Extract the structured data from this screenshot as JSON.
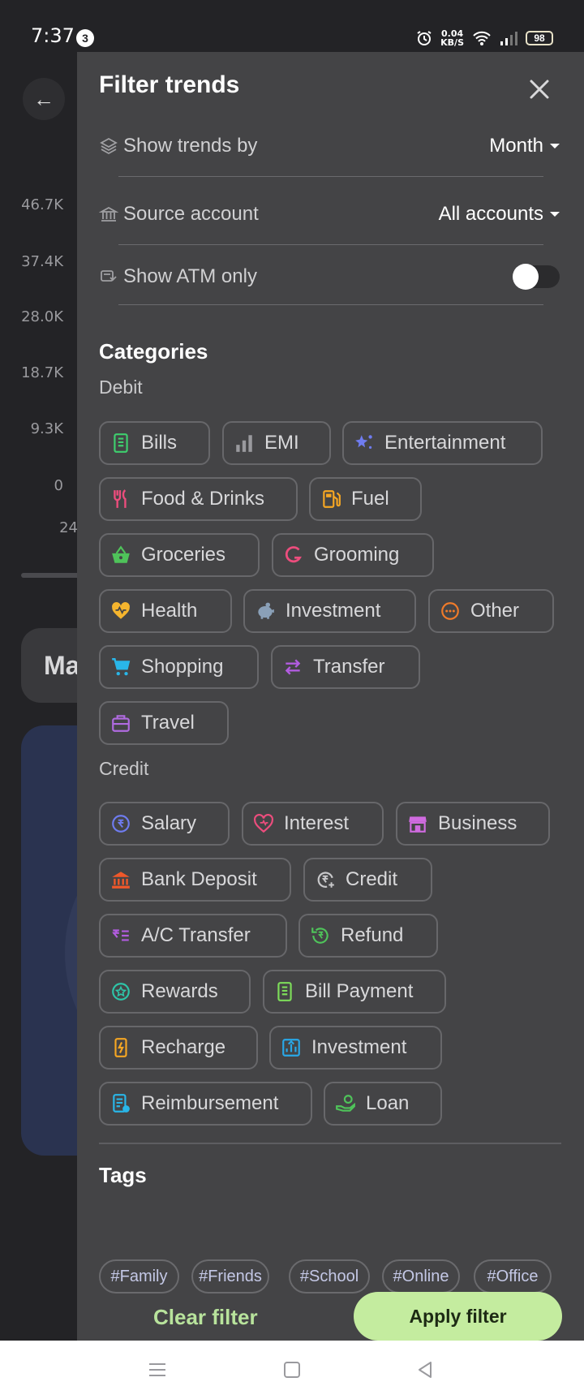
{
  "status_bar": {
    "time": "7:37",
    "notification_count": "3",
    "net_speed_value": "0.04",
    "net_speed_unit": "KB/S",
    "battery": "98"
  },
  "background": {
    "y_ticks": [
      "46.7K",
      "37.4K",
      "28.0K",
      "18.7K",
      "9.3K",
      "0"
    ],
    "x_tick_partial": "24",
    "card_text_partial": "Ma"
  },
  "drawer": {
    "title": "Filter trends",
    "show_trends_by": {
      "label": "Show trends by",
      "value": "Month"
    },
    "source_account": {
      "label": "Source account",
      "value": "All accounts"
    },
    "atm_only": {
      "label": "Show ATM only",
      "enabled": false
    },
    "categories_title": "Categories",
    "debit_title": "Debit",
    "debit": [
      {
        "label": "Bills",
        "icon": "bills-icon",
        "color": "#3ecf6e"
      },
      {
        "label": "EMI",
        "icon": "bars-icon",
        "color": "#9a9a9e"
      },
      {
        "label": "Entertainment",
        "icon": "stars-icon",
        "color": "#6f7cf0"
      },
      {
        "label": "Food & Drinks",
        "icon": "cutlery-icon",
        "color": "#ec4d7d"
      },
      {
        "label": "Fuel",
        "icon": "fuel-icon",
        "color": "#f5a623"
      },
      {
        "label": "Groceries",
        "icon": "basket-icon",
        "color": "#4fc35a"
      },
      {
        "label": "Grooming",
        "icon": "grooming-icon",
        "color": "#ec4d7d"
      },
      {
        "label": "Health",
        "icon": "heart-icon",
        "color": "#f5b52e"
      },
      {
        "label": "Investment",
        "icon": "piggy-bank-icon",
        "color": "#8aa0b8"
      },
      {
        "label": "Other",
        "icon": "more-icon",
        "color": "#f07b2a"
      },
      {
        "label": "Shopping",
        "icon": "cart-icon",
        "color": "#29b6e8"
      },
      {
        "label": "Transfer",
        "icon": "transfer-icon",
        "color": "#b25ce0"
      },
      {
        "label": "Travel",
        "icon": "suitcase-icon",
        "color": "#b06be0"
      }
    ],
    "credit_title": "Credit",
    "credit": [
      {
        "label": "Salary",
        "icon": "salary-icon",
        "color": "#6f7cf0"
      },
      {
        "label": "Interest",
        "icon": "interest-icon",
        "color": "#ec4d7d"
      },
      {
        "label": "Business",
        "icon": "store-icon",
        "color": "#d06be0"
      },
      {
        "label": "Bank Deposit",
        "icon": "bank-icon",
        "color": "#f0582a"
      },
      {
        "label": "Credit",
        "icon": "credit-icon",
        "color": "#c8c8ca"
      },
      {
        "label": "A/C Transfer",
        "icon": "ac-transfer-icon",
        "color": "#b25ce0"
      },
      {
        "label": "Refund",
        "icon": "refund-icon",
        "color": "#4fc35a"
      },
      {
        "label": "Rewards",
        "icon": "rewards-icon",
        "color": "#2ec4a8"
      },
      {
        "label": "Bill Payment",
        "icon": "bill-payment-icon",
        "color": "#7ddc5a"
      },
      {
        "label": "Recharge",
        "icon": "recharge-icon",
        "color": "#f5a623"
      },
      {
        "label": "Investment",
        "icon": "investment-chart-icon",
        "color": "#29a8e8"
      },
      {
        "label": "Reimbursement",
        "icon": "reimbursement-icon",
        "color": "#29b6e8"
      },
      {
        "label": "Loan",
        "icon": "loan-icon",
        "color": "#4fc35a"
      }
    ],
    "tags_title": "Tags",
    "tags": [
      "#Family",
      "#Friends",
      "#School",
      "#Online",
      "#Office"
    ],
    "clear_label": "Clear filter",
    "apply_label": "Apply filter"
  }
}
